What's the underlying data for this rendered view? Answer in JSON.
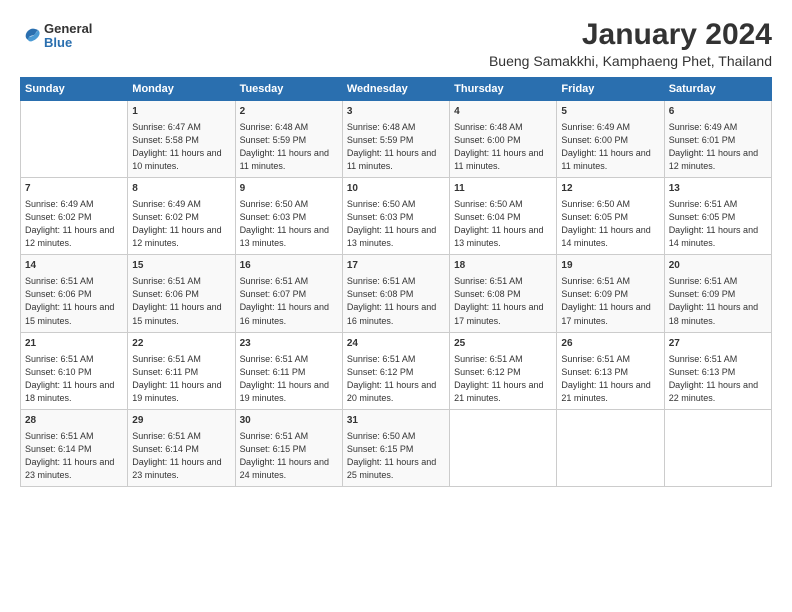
{
  "header": {
    "logo": {
      "general": "General",
      "blue": "Blue"
    },
    "title": "January 2024",
    "subtitle": "Bueng Samakkhi, Kamphaeng Phet, Thailand"
  },
  "calendar": {
    "days": [
      "Sunday",
      "Monday",
      "Tuesday",
      "Wednesday",
      "Thursday",
      "Friday",
      "Saturday"
    ],
    "weeks": [
      [
        {
          "date": "",
          "sunrise": "",
          "sunset": "",
          "daylight": ""
        },
        {
          "date": "1",
          "sunrise": "6:47 AM",
          "sunset": "5:58 PM",
          "daylight": "11 hours and 10 minutes."
        },
        {
          "date": "2",
          "sunrise": "6:48 AM",
          "sunset": "5:59 PM",
          "daylight": "11 hours and 11 minutes."
        },
        {
          "date": "3",
          "sunrise": "6:48 AM",
          "sunset": "5:59 PM",
          "daylight": "11 hours and 11 minutes."
        },
        {
          "date": "4",
          "sunrise": "6:48 AM",
          "sunset": "6:00 PM",
          "daylight": "11 hours and 11 minutes."
        },
        {
          "date": "5",
          "sunrise": "6:49 AM",
          "sunset": "6:00 PM",
          "daylight": "11 hours and 11 minutes."
        },
        {
          "date": "6",
          "sunrise": "6:49 AM",
          "sunset": "6:01 PM",
          "daylight": "11 hours and 12 minutes."
        }
      ],
      [
        {
          "date": "7",
          "sunrise": "6:49 AM",
          "sunset": "6:02 PM",
          "daylight": "11 hours and 12 minutes."
        },
        {
          "date": "8",
          "sunrise": "6:49 AM",
          "sunset": "6:02 PM",
          "daylight": "11 hours and 12 minutes."
        },
        {
          "date": "9",
          "sunrise": "6:50 AM",
          "sunset": "6:03 PM",
          "daylight": "11 hours and 13 minutes."
        },
        {
          "date": "10",
          "sunrise": "6:50 AM",
          "sunset": "6:03 PM",
          "daylight": "11 hours and 13 minutes."
        },
        {
          "date": "11",
          "sunrise": "6:50 AM",
          "sunset": "6:04 PM",
          "daylight": "11 hours and 13 minutes."
        },
        {
          "date": "12",
          "sunrise": "6:50 AM",
          "sunset": "6:05 PM",
          "daylight": "11 hours and 14 minutes."
        },
        {
          "date": "13",
          "sunrise": "6:51 AM",
          "sunset": "6:05 PM",
          "daylight": "11 hours and 14 minutes."
        }
      ],
      [
        {
          "date": "14",
          "sunrise": "6:51 AM",
          "sunset": "6:06 PM",
          "daylight": "11 hours and 15 minutes."
        },
        {
          "date": "15",
          "sunrise": "6:51 AM",
          "sunset": "6:06 PM",
          "daylight": "11 hours and 15 minutes."
        },
        {
          "date": "16",
          "sunrise": "6:51 AM",
          "sunset": "6:07 PM",
          "daylight": "11 hours and 16 minutes."
        },
        {
          "date": "17",
          "sunrise": "6:51 AM",
          "sunset": "6:08 PM",
          "daylight": "11 hours and 16 minutes."
        },
        {
          "date": "18",
          "sunrise": "6:51 AM",
          "sunset": "6:08 PM",
          "daylight": "11 hours and 17 minutes."
        },
        {
          "date": "19",
          "sunrise": "6:51 AM",
          "sunset": "6:09 PM",
          "daylight": "11 hours and 17 minutes."
        },
        {
          "date": "20",
          "sunrise": "6:51 AM",
          "sunset": "6:09 PM",
          "daylight": "11 hours and 18 minutes."
        }
      ],
      [
        {
          "date": "21",
          "sunrise": "6:51 AM",
          "sunset": "6:10 PM",
          "daylight": "11 hours and 18 minutes."
        },
        {
          "date": "22",
          "sunrise": "6:51 AM",
          "sunset": "6:11 PM",
          "daylight": "11 hours and 19 minutes."
        },
        {
          "date": "23",
          "sunrise": "6:51 AM",
          "sunset": "6:11 PM",
          "daylight": "11 hours and 19 minutes."
        },
        {
          "date": "24",
          "sunrise": "6:51 AM",
          "sunset": "6:12 PM",
          "daylight": "11 hours and 20 minutes."
        },
        {
          "date": "25",
          "sunrise": "6:51 AM",
          "sunset": "6:12 PM",
          "daylight": "11 hours and 21 minutes."
        },
        {
          "date": "26",
          "sunrise": "6:51 AM",
          "sunset": "6:13 PM",
          "daylight": "11 hours and 21 minutes."
        },
        {
          "date": "27",
          "sunrise": "6:51 AM",
          "sunset": "6:13 PM",
          "daylight": "11 hours and 22 minutes."
        }
      ],
      [
        {
          "date": "28",
          "sunrise": "6:51 AM",
          "sunset": "6:14 PM",
          "daylight": "11 hours and 23 minutes."
        },
        {
          "date": "29",
          "sunrise": "6:51 AM",
          "sunset": "6:14 PM",
          "daylight": "11 hours and 23 minutes."
        },
        {
          "date": "30",
          "sunrise": "6:51 AM",
          "sunset": "6:15 PM",
          "daylight": "11 hours and 24 minutes."
        },
        {
          "date": "31",
          "sunrise": "6:50 AM",
          "sunset": "6:15 PM",
          "daylight": "11 hours and 25 minutes."
        },
        {
          "date": "",
          "sunrise": "",
          "sunset": "",
          "daylight": ""
        },
        {
          "date": "",
          "sunrise": "",
          "sunset": "",
          "daylight": ""
        },
        {
          "date": "",
          "sunrise": "",
          "sunset": "",
          "daylight": ""
        }
      ]
    ]
  }
}
